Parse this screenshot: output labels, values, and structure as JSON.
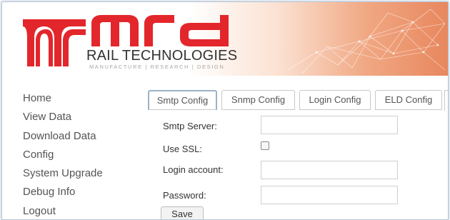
{
  "brand": {
    "name": "mrd",
    "subtitle": "RAIL TECHNOLOGIES",
    "tagline": "MANUFACTURE | RESEARCH | DESIGN",
    "colors": {
      "red": "#e3262b",
      "header_accent": "#e8875e"
    },
    "icon": "mrd-rail-logo-icon"
  },
  "sidebar": {
    "items": [
      {
        "label": "Home"
      },
      {
        "label": "View Data"
      },
      {
        "label": "Download Data"
      },
      {
        "label": "Config"
      },
      {
        "label": "System Upgrade"
      },
      {
        "label": "Debug Info"
      },
      {
        "label": "Logout"
      }
    ]
  },
  "tabs": [
    {
      "label": "Smtp Config",
      "active": true
    },
    {
      "label": "Snmp Config",
      "active": false
    },
    {
      "label": "Login Config",
      "active": false
    },
    {
      "label": "ELD Config",
      "active": false
    }
  ],
  "form": {
    "smtp_server_label": "Smtp Server:",
    "smtp_server_value": "",
    "use_ssl_label": "Use SSL:",
    "use_ssl_checked": false,
    "login_account_label": "Login account:",
    "login_account_value": "",
    "password_label": "Password:",
    "password_value": "",
    "save_label": "Save"
  }
}
